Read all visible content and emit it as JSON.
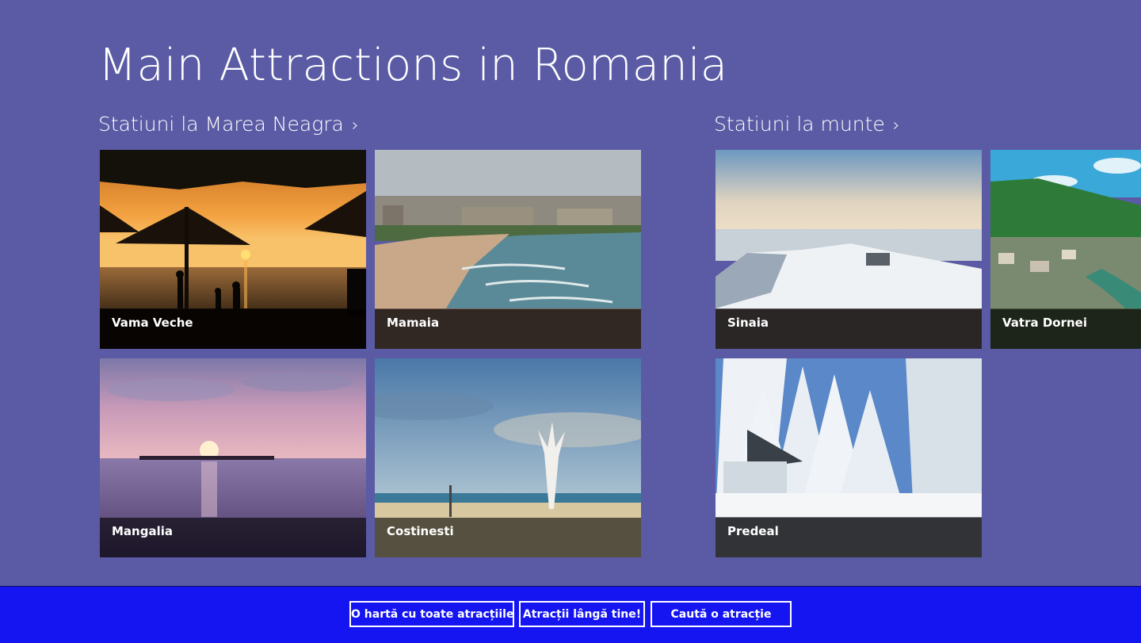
{
  "page": {
    "title": "Main Attractions in Romania"
  },
  "groups": [
    {
      "header": "Statiuni la Marea Neagra",
      "chevron": "›",
      "tiles": [
        {
          "label": "Vama Veche",
          "scene": "beach-sunset-umbrellas"
        },
        {
          "label": "Mamaia",
          "scene": "crowded-beach-city"
        },
        {
          "label": "Mangalia",
          "scene": "purple-sunset-sea"
        },
        {
          "label": "Costinesti",
          "scene": "beach-white-sculpture"
        }
      ]
    },
    {
      "header": "Statiuni la munte",
      "chevron": "›",
      "tiles": [
        {
          "label": "Sinaia",
          "scene": "snowy-mountain-top"
        },
        {
          "label": "Vatra Dornei",
          "scene": "green-mountain-town"
        },
        {
          "label": "Predeal",
          "scene": "snowy-pine-forest"
        }
      ]
    }
  ],
  "appbar": {
    "buttons": [
      {
        "label": "O hartă cu toate atracțiile"
      },
      {
        "label": "Atracții lângă tine!"
      },
      {
        "label": "Caută o atracție"
      }
    ]
  },
  "colors": {
    "background": "#5a5ba4",
    "appbar": "#1515f2",
    "caption_overlay": "rgba(0,0,0,0.6)"
  }
}
